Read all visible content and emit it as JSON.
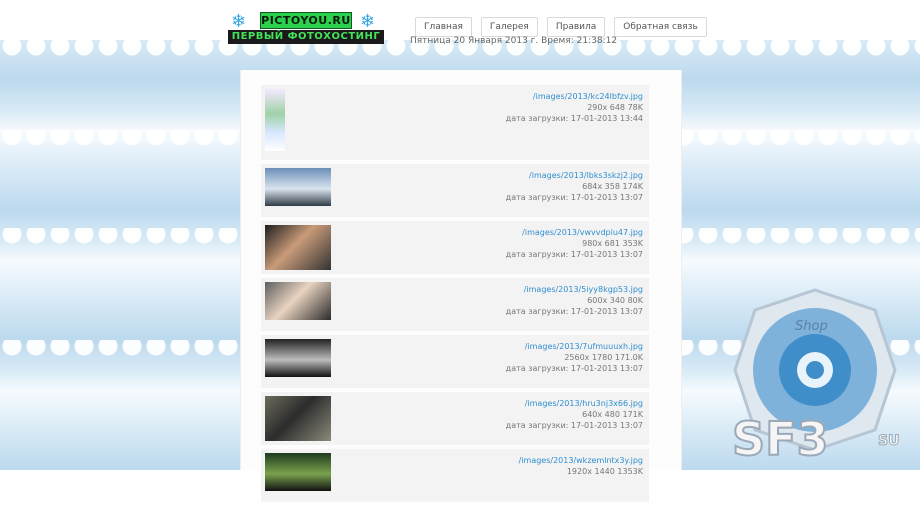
{
  "logo": {
    "title": "PICTOYOU.RU",
    "subtitle": "ПЕРВЫЙ ФОТОХОСТИНГ"
  },
  "nav": [
    {
      "label": "Главная"
    },
    {
      "label": "Галерея"
    },
    {
      "label": "Правила"
    },
    {
      "label": "Обратная связь"
    }
  ],
  "date_text": "Пятница 20 Января 2013 г. Время: 21:38:12",
  "items": [
    {
      "link": "/images/2013/kc24lbfzv.jpg",
      "dims": "290x 648 78K",
      "date": "дата загрузки: 17-01-2013 13:44"
    },
    {
      "link": "/images/2013/lbks3skzj2.jpg",
      "dims": "684x 358 174K",
      "date": "дата загрузки: 17-01-2013 13:07"
    },
    {
      "link": "/images/2013/vwvvdpiu47.jpg",
      "dims": "980x 681 353K",
      "date": "дата загрузки: 17-01-2013 13:07"
    },
    {
      "link": "/images/2013/5iyy8kgp53.jpg",
      "dims": "600x 340 80K",
      "date": "дата загрузки: 17-01-2013 13:07"
    },
    {
      "link": "/images/2013/7ufmuuuxh.jpg",
      "dims": "2560x 1780 171.0K",
      "date": "дата загрузки: 17-01-2013 13:07"
    },
    {
      "link": "/images/2013/hru3nj3x66.jpg",
      "dims": "640x 480 171K",
      "date": "дата загрузки: 17-01-2013 13:07"
    },
    {
      "link": "/images/2013/wkzemlntx3y.jpg",
      "dims": "1920x 1440 1353K",
      "date": ""
    }
  ],
  "watermark": {
    "brand": "SF3",
    "suffix": "SU",
    "shop": "Shop"
  }
}
